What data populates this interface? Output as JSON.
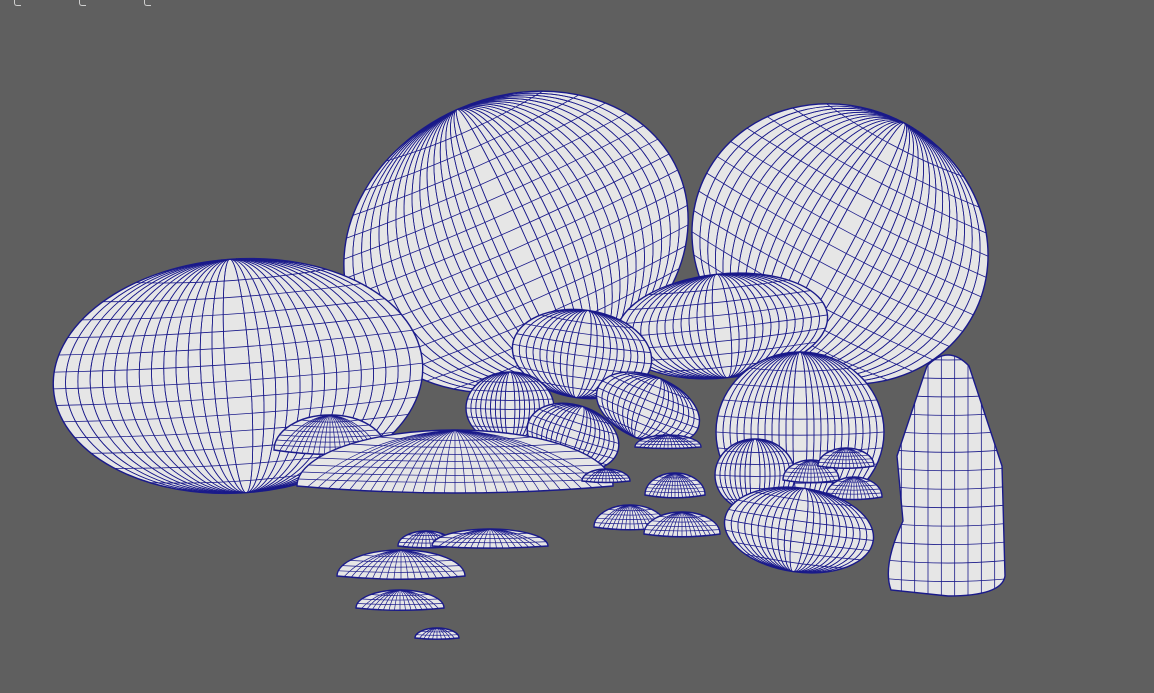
{
  "viewport": {
    "background": "#5f5f5f",
    "mesh_fill": "#e6e6e6",
    "wire_color": "#1a1a8a",
    "objects": [
      {
        "name": "rock-large-left"
      },
      {
        "name": "rock-large-center"
      },
      {
        "name": "rock-large-right"
      },
      {
        "name": "rock-slab-front"
      },
      {
        "name": "rock-dome-left"
      },
      {
        "name": "rock-capsule"
      },
      {
        "name": "rock-mid-a"
      },
      {
        "name": "rock-mid-b"
      },
      {
        "name": "rock-mid-c"
      },
      {
        "name": "rock-mid-d"
      },
      {
        "name": "rock-mid-e"
      },
      {
        "name": "rock-right-cluster"
      },
      {
        "name": "rock-pillar"
      },
      {
        "name": "rock-small-1"
      },
      {
        "name": "rock-small-2"
      },
      {
        "name": "rock-small-3"
      },
      {
        "name": "rock-small-4"
      },
      {
        "name": "rock-small-5"
      },
      {
        "name": "rock-small-6"
      },
      {
        "name": "rock-small-7"
      },
      {
        "name": "rock-small-8"
      },
      {
        "name": "rock-small-9"
      },
      {
        "name": "rock-small-10"
      },
      {
        "name": "rock-small-11"
      },
      {
        "name": "rock-small-12"
      },
      {
        "name": "rock-small-13"
      },
      {
        "name": "rock-small-14"
      }
    ]
  }
}
